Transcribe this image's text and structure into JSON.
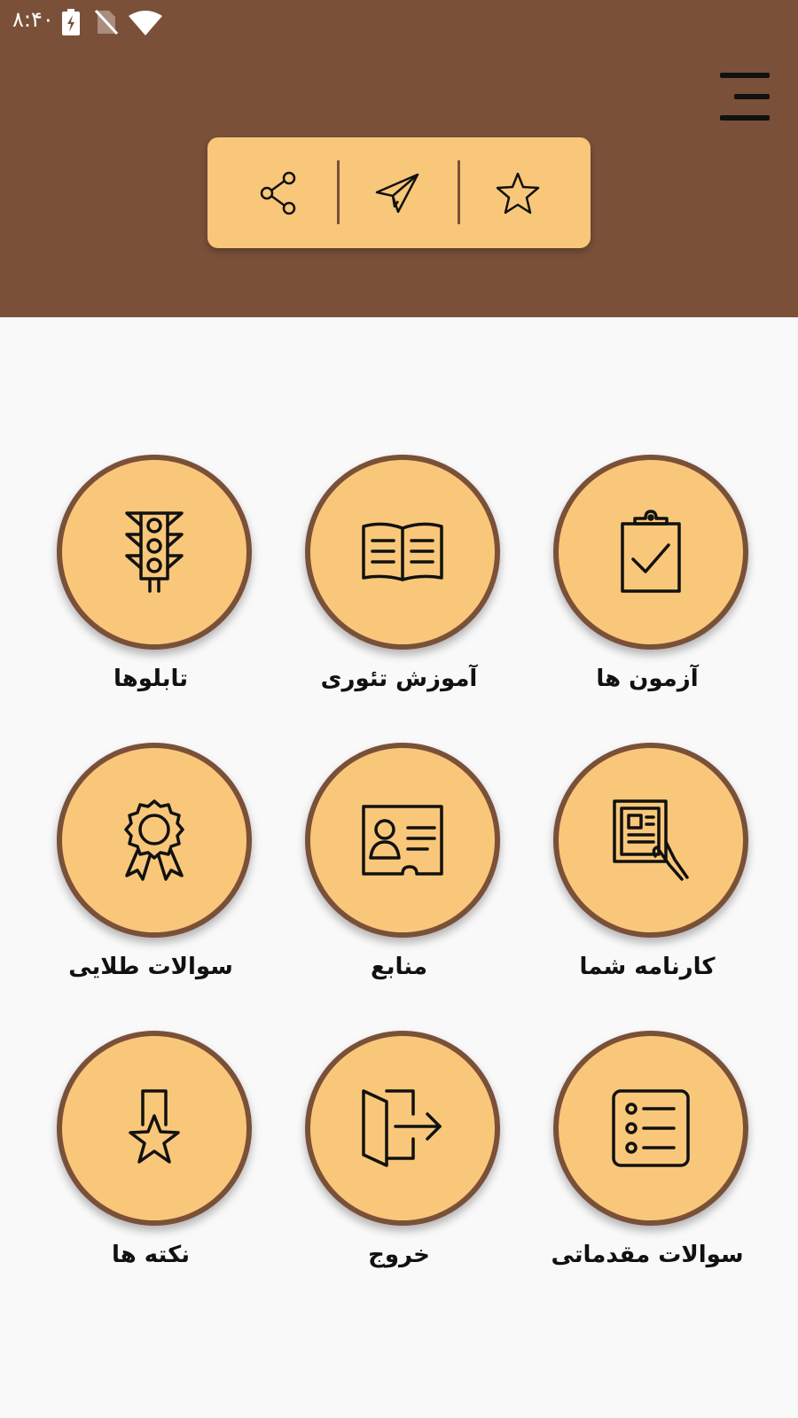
{
  "status_bar": {
    "time": "۸:۴۰",
    "icons": [
      "battery-charging-icon",
      "no-sim-icon",
      "wifi-icon"
    ]
  },
  "header": {
    "background_color": "#7a5039",
    "menu_icon": "hamburger-menu-icon",
    "actions": [
      {
        "name": "share",
        "icon": "share-icon"
      },
      {
        "name": "send",
        "icon": "send-paper-plane-icon"
      },
      {
        "name": "rate",
        "icon": "star-icon"
      }
    ]
  },
  "colors": {
    "accent": "#f9c779",
    "brand": "#7a5039",
    "background": "#f9f9f9"
  },
  "menu": {
    "items": [
      {
        "label": "آزمون ها",
        "icon": "clipboard-check-icon"
      },
      {
        "label": "آموزش تئوری",
        "icon": "open-book-icon"
      },
      {
        "label": "تابلوها",
        "icon": "traffic-light-icon"
      },
      {
        "label": "کارنامه شما",
        "icon": "report-card-hand-icon"
      },
      {
        "label": "منابع",
        "icon": "id-card-icon"
      },
      {
        "label": "سوالات طلایی",
        "icon": "award-badge-icon"
      },
      {
        "label": "سوالات مقدماتی",
        "icon": "list-icon"
      },
      {
        "label": "خروج",
        "icon": "exit-door-icon"
      },
      {
        "label": "نکته ها",
        "icon": "bookmark-star-icon"
      }
    ]
  }
}
